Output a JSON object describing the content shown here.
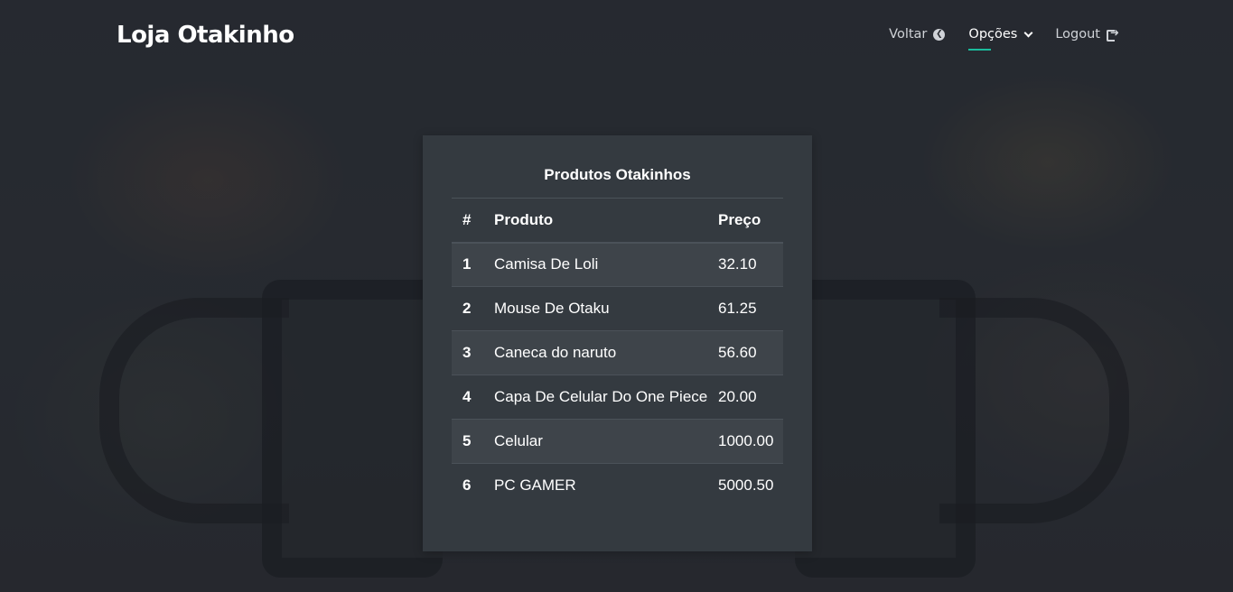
{
  "header": {
    "brand": "Loja Otakinho",
    "nav": {
      "voltar": "Voltar",
      "opcoes": "Opções",
      "logout": "Logout"
    }
  },
  "card": {
    "title": "Produtos Otakinhos",
    "columns": [
      "#",
      "Produto",
      "Preço"
    ],
    "rows": [
      {
        "id": "1",
        "produto": "Camisa De Loli",
        "preco": "32.10"
      },
      {
        "id": "2",
        "produto": "Mouse De Otaku",
        "preco": "61.25"
      },
      {
        "id": "3",
        "produto": "Caneca do naruto",
        "preco": "56.60"
      },
      {
        "id": "4",
        "produto": "Capa De Celular Do One Piece",
        "preco": "20.00"
      },
      {
        "id": "5",
        "produto": "Celular",
        "preco": "1000.00"
      },
      {
        "id": "6",
        "produto": "PC GAMER",
        "preco": "5000.50"
      }
    ]
  },
  "colors": {
    "accent": "#1abc9c",
    "card_bg": "#343a40",
    "page_bg": "#2a2d33"
  },
  "icons": {
    "voltar": "arrow-left-circle-icon",
    "opcoes": "chevron-down-icon",
    "logout": "sign-out-icon"
  }
}
